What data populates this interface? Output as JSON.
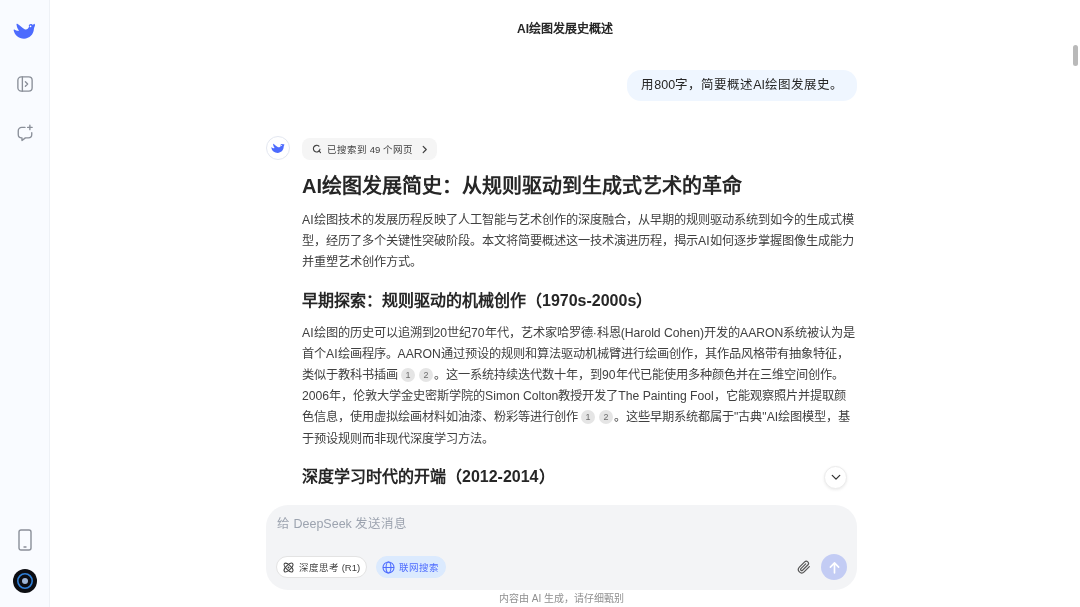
{
  "header": {
    "title": "AI绘图发展史概述"
  },
  "messages": [
    {
      "kind": "user",
      "text": "用800字，简要概述AI绘图发展史。"
    },
    {
      "kind": "assistant",
      "search_chip": "已搜索到 49 个网页",
      "blocks": [
        {
          "kind": "title",
          "text": "AI绘图发展简史：从规则驱动到生成式艺术的革命"
        },
        {
          "kind": "paragraph",
          "parts": [
            {
              "kind": "text",
              "text": "AI绘图技术的发展历程反映了人工智能与艺术创作的深度融合，从早期的规则驱动系统到如今的生成式模型，经历了多个关键性突破阶段。本文将简要概述这一技术演进历程，揭示AI如何逐步掌握图像生成能力并重塑艺术创作方式。"
            }
          ]
        },
        {
          "kind": "heading",
          "text": "早期探索：规则驱动的机械创作（1970s-2000s）"
        },
        {
          "kind": "paragraph",
          "parts": [
            {
              "kind": "text",
              "text": "AI绘图的历史可以追溯到20世纪70年代，艺术家哈罗德·科恩(Harold Cohen)开发的AARON系统被认为是首个AI绘画程序。AARON通过预设的规则和算法驱动机械臂进行绘画创作，其作品风格带有抽象特征，类似于教科书插画"
            },
            {
              "kind": "citation",
              "label": "1"
            },
            {
              "kind": "citation",
              "label": "2"
            },
            {
              "kind": "text",
              "text": "。这一系统持续迭代数十年，到90年代已能使用多种颜色并在三维空间创作。2006年，伦敦大学金史密斯学院的Simon Colton教授开发了The Painting Fool，它能观察照片并提取颜色信息，使用虚拟绘画材料如油漆、粉彩等进行创作"
            },
            {
              "kind": "citation",
              "label": "1"
            },
            {
              "kind": "citation",
              "label": "2"
            },
            {
              "kind": "text",
              "text": "。这些早期系统都属于\"古典\"AI绘图模型，基于预设规则而非现代深度学习方法。"
            }
          ]
        },
        {
          "kind": "heading",
          "text": "深度学习时代的开端（2012-2014）"
        }
      ]
    }
  ],
  "composer": {
    "placeholder": "给 DeepSeek 发送消息",
    "toggles": [
      {
        "kind": "think",
        "label": "深度思考 (R1)",
        "selected": false
      },
      {
        "kind": "search",
        "label": "联网搜索",
        "selected": true
      }
    ],
    "send_button": {
      "disabled": true
    }
  },
  "disclaimer": "内容由 AI 生成，请仔细甄别"
}
